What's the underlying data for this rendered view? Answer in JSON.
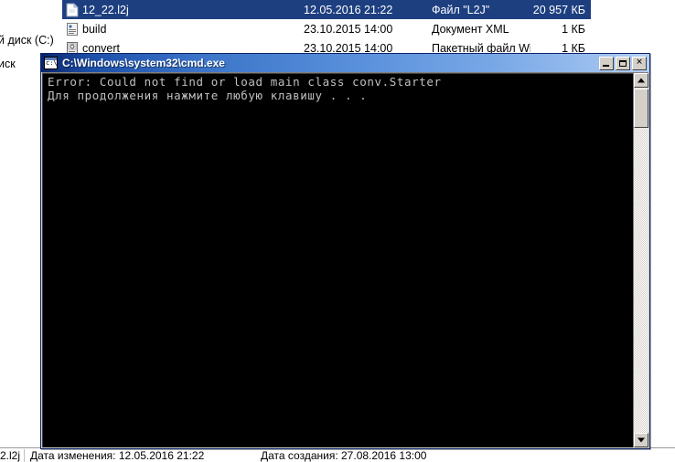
{
  "explorer": {
    "sidebar": {
      "items": [
        {
          "label": "й диск (C:)",
          "name": "sidebar-item-local-disk-c"
        },
        {
          "label": "иск",
          "name": "sidebar-item-disk"
        }
      ]
    },
    "file_list": {
      "rows": [
        {
          "icon": "generic-file-icon",
          "name": "12_22.l2j",
          "date": "12.05.2016 21:22",
          "type": "Файл \"L2J\"",
          "size": "20 957 КБ",
          "selected": true
        },
        {
          "icon": "xml-document-icon",
          "name": "build",
          "date": "23.10.2015 14:00",
          "type": "Документ XML",
          "size": "1 КБ",
          "selected": false
        },
        {
          "icon": "batch-file-icon",
          "name": "convert",
          "date": "23.10.2015 14:00",
          "type": "Пакетный файл Wi",
          "size": "1 КБ",
          "selected": false
        }
      ]
    },
    "status_bar": {
      "file_name": "2.l2j",
      "modified": "Дата изменения: 12.05.2016 21:22",
      "created": "Дата создания: 27.08.2016 13:00"
    }
  },
  "cmd_window": {
    "title": "C:\\Windows\\system32\\cmd.exe",
    "icon_label": "c:\\",
    "buttons": {
      "minimize": "_",
      "maximize": "□",
      "close": "✕"
    },
    "console": {
      "lines": [
        "Error: Could not find or load main class conv.Starter",
        "Для продолжения нажмите любую клавишу . . ."
      ]
    },
    "scrollbar": {
      "up_arrow": "▲",
      "down_arrow": "▼"
    }
  },
  "colors": {
    "selection_blue": "#1d3f80",
    "titlebar_start": "#0a246a",
    "titlebar_end": "#b5d0f5",
    "console_bg": "#000000",
    "console_fg": "#c0c0c0",
    "window_face": "#d4d0c8"
  }
}
